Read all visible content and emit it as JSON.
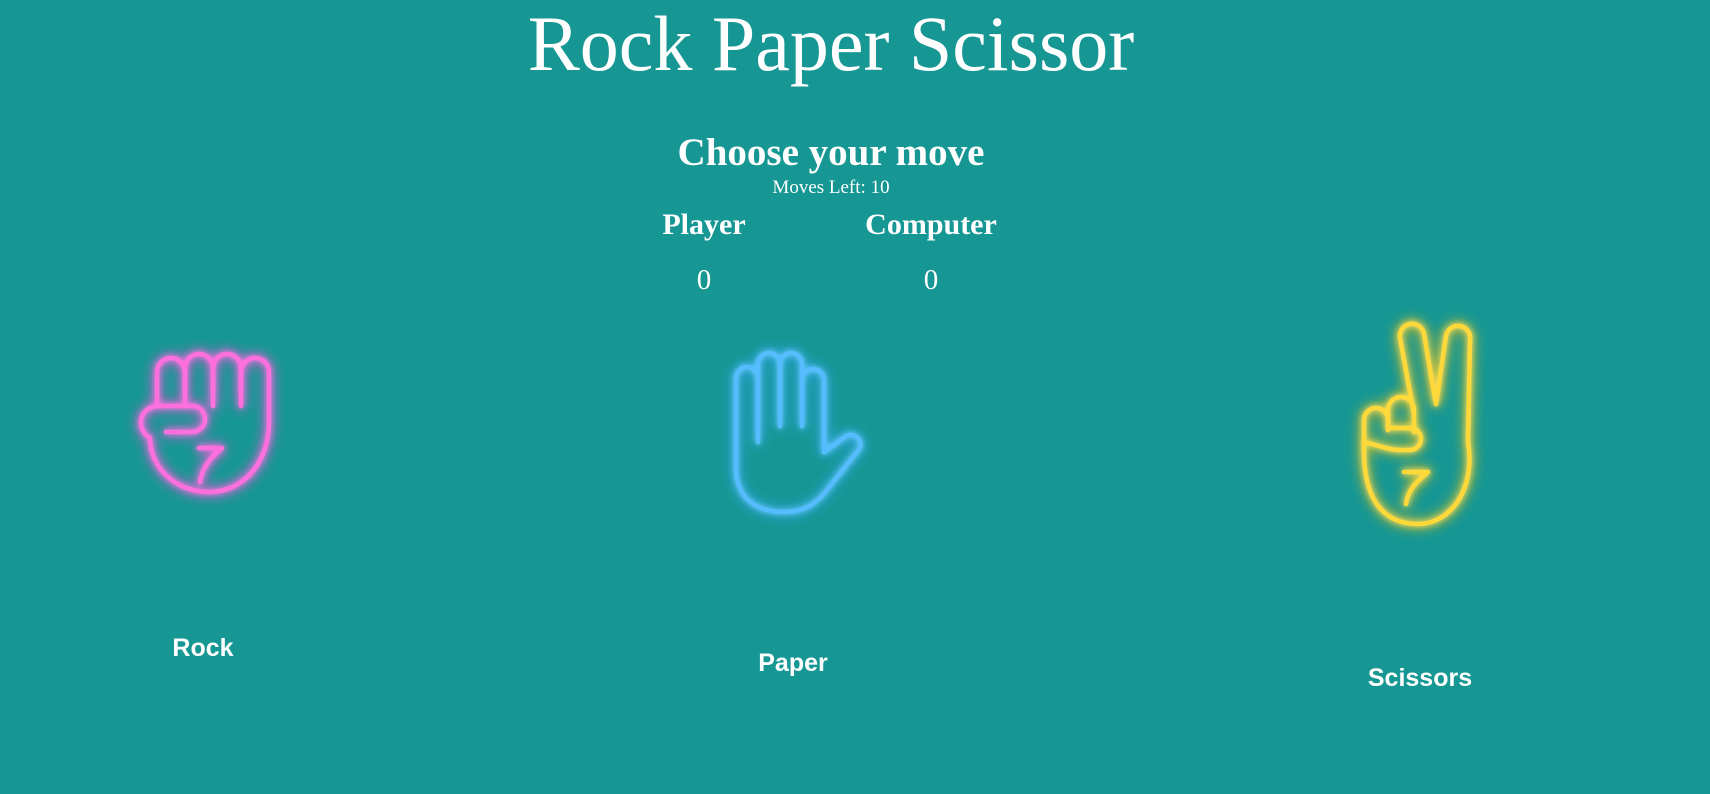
{
  "title": "Rock Paper Scissor",
  "prompt": "Choose your move",
  "moves_left": "Moves Left: 10",
  "scoreboard": {
    "player_label": "Player",
    "computer_label": "Computer",
    "player_score": "0",
    "computer_score": "0"
  },
  "choices": [
    {
      "label": "Rock",
      "icon": "fist-icon",
      "color": "#ff5fd6"
    },
    {
      "label": "Paper",
      "icon": "open-hand-icon",
      "color": "#52b9ff"
    },
    {
      "label": "Scissors",
      "icon": "peace-hand-icon",
      "color": "#ffd83a"
    }
  ],
  "colors": {
    "background": "#169794",
    "text": "#ffffff"
  }
}
